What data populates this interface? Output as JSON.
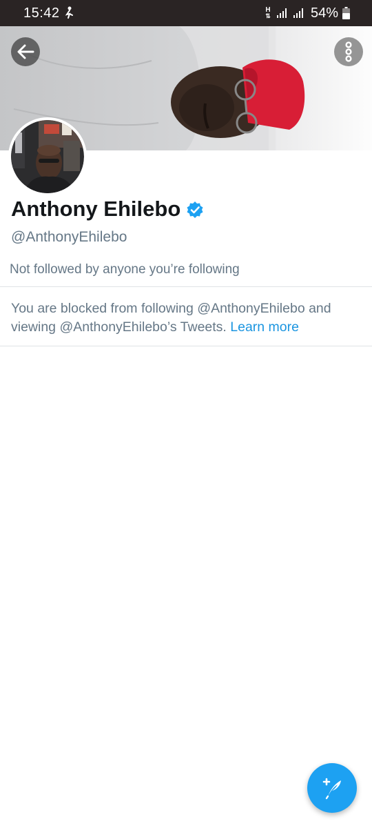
{
  "status_bar": {
    "time": "15:42",
    "network_label": "H",
    "battery_percent": "54%"
  },
  "profile": {
    "display_name": "Anthony Ehilebo",
    "handle": "@AnthonyEhilebo",
    "verified": true,
    "followed_by": "Not followed by anyone you’re following"
  },
  "blocked_notice": {
    "text": "You are blocked from following @AnthonyEhilebo and viewing @AnthonyEhilebo’s Tweets.",
    "link_label": "Learn more"
  },
  "icons": {
    "back": "arrow-left-icon",
    "more": "more-vertical-icon",
    "verified": "verified-badge-icon",
    "compose": "compose-tweet-icon"
  },
  "colors": {
    "status_bar_bg": "#2a2424",
    "accent": "#1da1f2",
    "link": "#1b95e0",
    "secondary_text": "#657786",
    "primary_text": "#14171a"
  }
}
